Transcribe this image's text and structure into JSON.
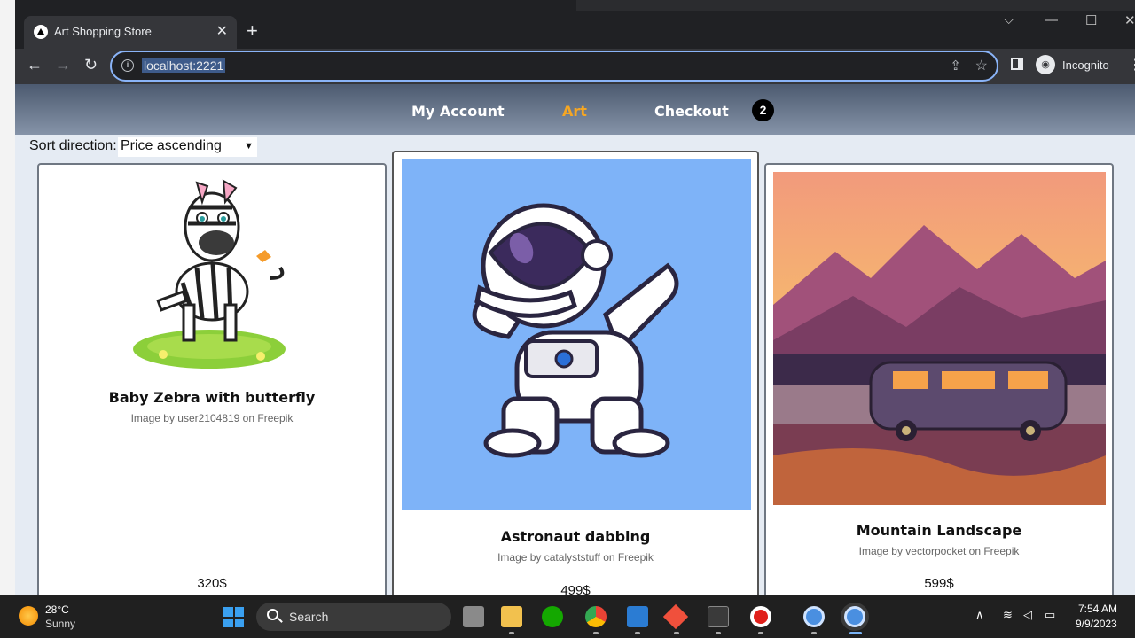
{
  "browser": {
    "tab_title": "Art Shopping Store",
    "tab_close": "✕",
    "new_tab": "+",
    "url": "localhost:2221",
    "profile_label": "Incognito"
  },
  "site_nav": {
    "links": [
      "My Account",
      "Art",
      "Checkout"
    ],
    "active_link": "Art",
    "active_color": "#f5a623",
    "cart_count": "2"
  },
  "sort": {
    "label": "Sort direction:",
    "selected": "Price ascending"
  },
  "products": [
    {
      "title": "Baby Zebra with butterfly",
      "credit": "Image by user2104819 on Freepik",
      "price": "320$"
    },
    {
      "title": "Astronaut dabbing",
      "credit": "Image by catalyststuff on Freepik",
      "price": "499$"
    },
    {
      "title": "Mountain Landscape",
      "credit": "Image by vectorpocket on Freepik",
      "price": "599$"
    }
  ],
  "taskbar": {
    "weather_temp": "28°C",
    "weather_condition": "Sunny",
    "search_placeholder": "Search",
    "time": "7:54 AM",
    "date": "9/9/2023",
    "apps": [
      "file-explorer",
      "upwork",
      "chrome",
      "vscode",
      "git",
      "terminal",
      "recorder",
      "chrome-profile",
      "chrome-active"
    ]
  }
}
